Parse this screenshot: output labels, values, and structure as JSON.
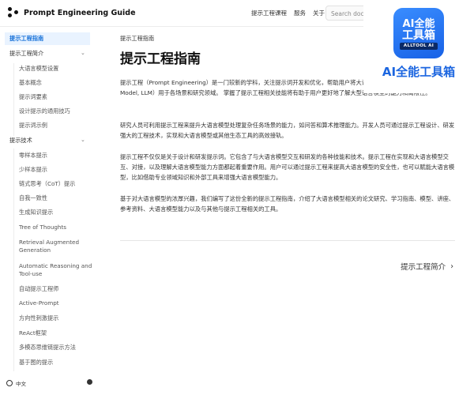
{
  "header": {
    "brand_title": "Prompt Engineering Guide",
    "nav": [
      "提示工程课程",
      "服务",
      "关于"
    ],
    "search_placeholder": "Search docu"
  },
  "sidebar": {
    "items": [
      {
        "label": "提示工程指南",
        "kind": "active"
      },
      {
        "label": "提示工程简介",
        "kind": "section",
        "chevron": true
      },
      {
        "label": "大语言模型设置",
        "kind": "sub"
      },
      {
        "label": "基本概念",
        "kind": "sub"
      },
      {
        "label": "提示词要素",
        "kind": "sub"
      },
      {
        "label": "设计提示的通用技巧",
        "kind": "sub"
      },
      {
        "label": "提示词示例",
        "kind": "sub"
      },
      {
        "label": "提示技术",
        "kind": "section",
        "chevron": true
      },
      {
        "label": "零样本提示",
        "kind": "sub"
      },
      {
        "label": "少样本提示",
        "kind": "sub"
      },
      {
        "label": "链式思考（CoT）提示",
        "kind": "sub"
      },
      {
        "label": "自我一致性",
        "kind": "sub"
      },
      {
        "label": "生成知识提示",
        "kind": "sub"
      },
      {
        "label": "Tree of Thoughts",
        "kind": "sub"
      },
      {
        "label": "Retrieval Augmented\nGeneration",
        "kind": "sub"
      },
      {
        "label": "Automatic Reasoning and\nTool-use",
        "kind": "sub"
      },
      {
        "label": "自动提示工程师",
        "kind": "sub"
      },
      {
        "label": "Active-Prompt",
        "kind": "sub"
      },
      {
        "label": "方向性刺激提示",
        "kind": "sub"
      },
      {
        "label": "ReAct框架",
        "kind": "sub"
      },
      {
        "label": "多模态思维链提示方法",
        "kind": "sub"
      },
      {
        "label": "基于图的提示",
        "kind": "sub"
      }
    ],
    "language": "中文"
  },
  "main": {
    "breadcrumb": "提示工程指南",
    "title": "提示工程指南",
    "paragraphs": [
      "提示工程（Prompt Engineering）是一门较新的学科，关注提示词开发和优化，帮助用户将大语言模型（Large Language Model, LLM）用于各场景和研究领域。 掌握了提示工程相关技能将有助于用户更好地了解大型语言模型的能力和局限性。",
      "研究人员可利用提示工程来提升大语言模型处理复杂任务场景的能力，如问答和算术推理能力。开发人员可通过提示工程设计、研发强大的工程技术，实现和大语言模型或其他生态工具的高效接轨。",
      "提示工程不仅仅是关于设计和研发提示词。它包含了与大语言模型交互和研发的各种技能和技术。提示工程在实现和大语言模型交互、对接，以及理解大语言模型能力方面都起着重要作用。用户可以通过提示工程来提高大语言模型的安全性，也可以赋能大语言模型，比如借助专业领域知识和外部工具来增强大语言模型能力。",
      "基于对大语言模型的浓厚兴趣，我们编写了这份全新的提示工程指南，介绍了大语言模型相关的论文研究、学习指南、模型、讲座、参考资料、大语言模型能力以及与其他与提示工程相关的工具。"
    ],
    "next_label": "提示工程简介"
  },
  "overlay": {
    "icon_line1": "AI全能",
    "icon_line2": "工具箱",
    "icon_line3": "ALLTOOL AI",
    "label": "AI全能工具箱"
  },
  "colors": {
    "accent": "#1a73d9",
    "active_bg": "#e9f3ff",
    "overlay_blue": "#1c66e0"
  }
}
